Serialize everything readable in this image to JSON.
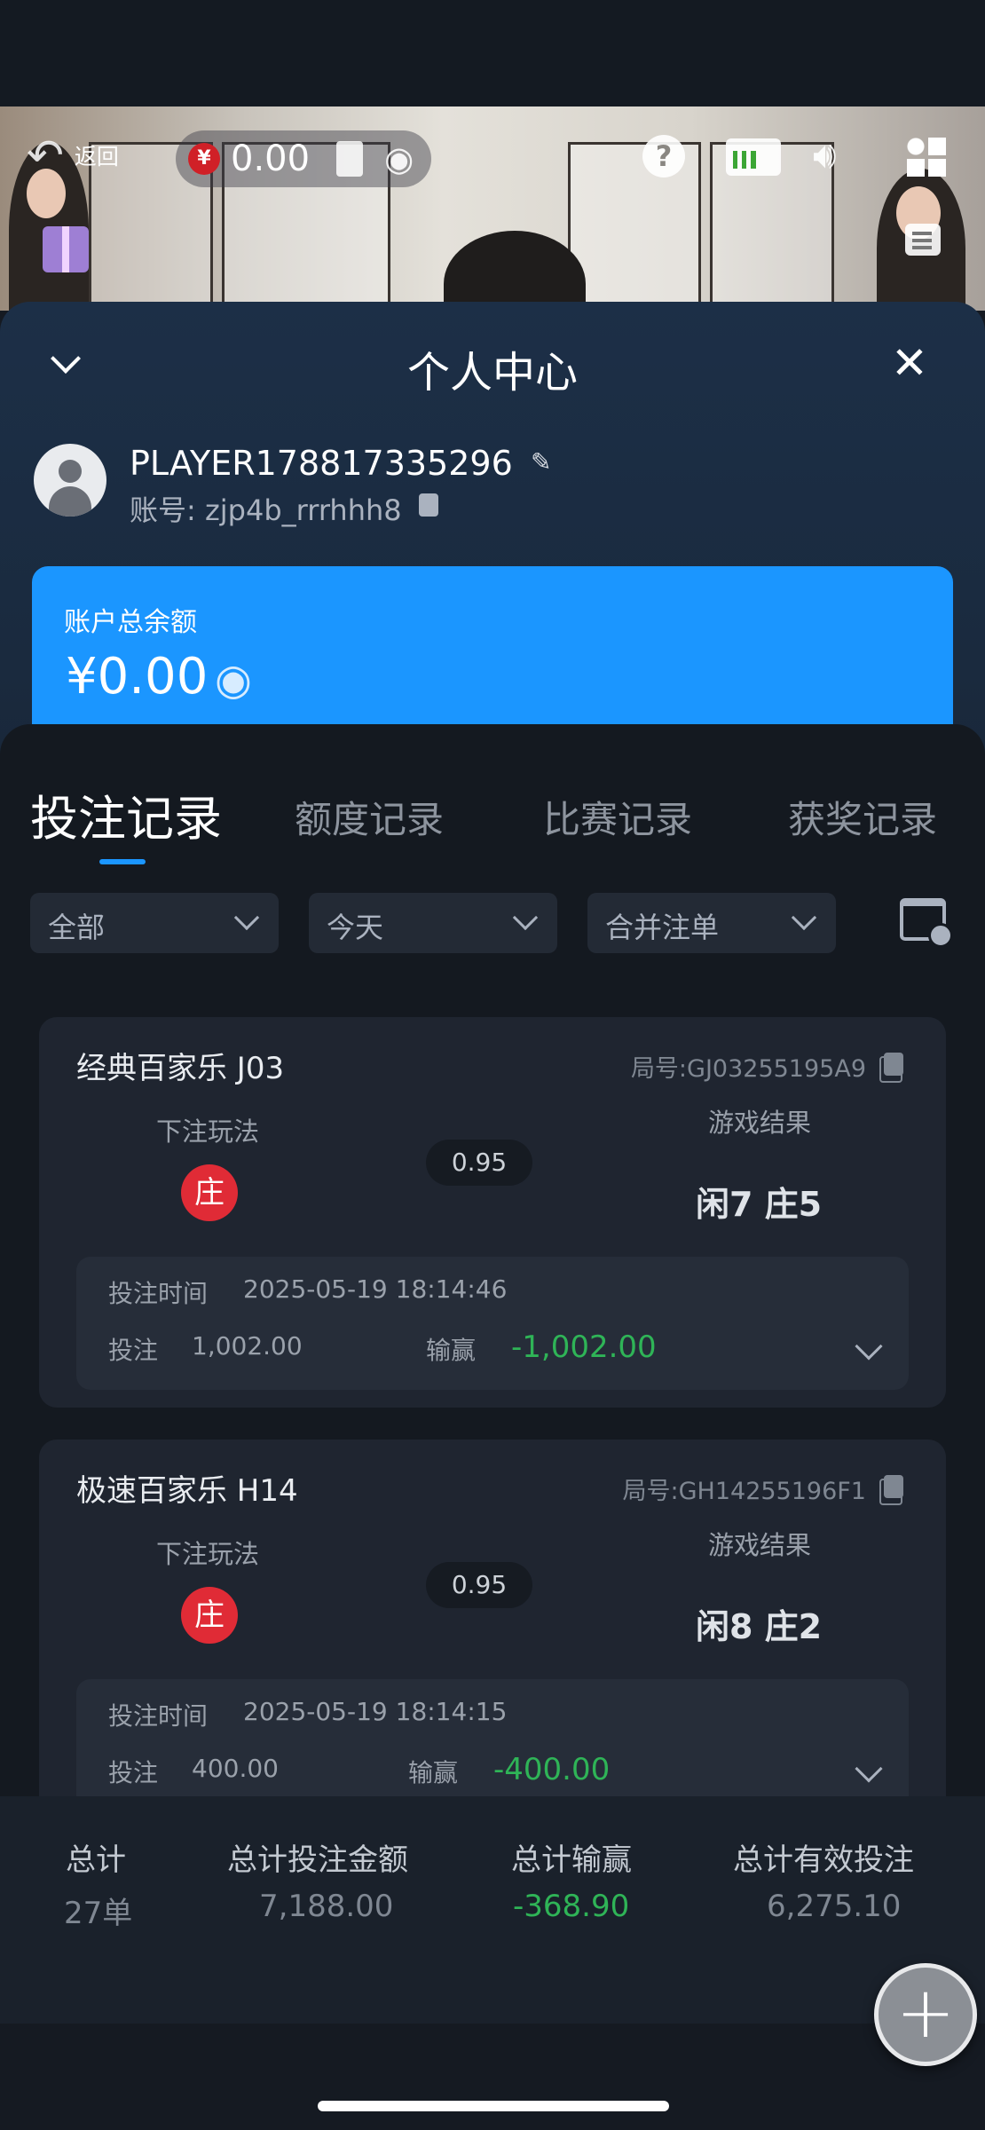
{
  "video_bar": {
    "back_label": "返回",
    "currency_symbol": "¥",
    "balance": "0.00"
  },
  "sheet": {
    "title": "个人中心"
  },
  "profile": {
    "name": "PLAYER178817335296",
    "account": "账号: zjp4b_rrrhhh8"
  },
  "balance_card": {
    "label": "账户总余额",
    "amount": "¥0.00"
  },
  "tabs": [
    {
      "label": "投注记录",
      "active": true
    },
    {
      "label": "额度记录",
      "active": false
    },
    {
      "label": "比赛记录",
      "active": false
    },
    {
      "label": "获奖记录",
      "active": false
    }
  ],
  "filters": [
    {
      "value": "全部"
    },
    {
      "value": "今天"
    },
    {
      "value": "合并注单"
    }
  ],
  "records": [
    {
      "game": "经典百家乐 J03",
      "round": "局号:GJ03255195A9",
      "play_label": "下注玩法",
      "bet": "庄",
      "odds": "0.95",
      "result_label": "游戏结果",
      "result": "闲7 庄5",
      "time_label": "投注时间",
      "time": "2025-05-19 18:14:46",
      "stake_label": "投注",
      "stake": "1,002.00",
      "winloss_label": "输赢",
      "winloss": "-1,002.00"
    },
    {
      "game": "极速百家乐 H14",
      "round": "局号:GH14255196F1",
      "play_label": "下注玩法",
      "bet": "庄",
      "odds": "0.95",
      "result_label": "游戏结果",
      "result": "闲8 庄2",
      "time_label": "投注时间",
      "time": "2025-05-19 18:14:15",
      "stake_label": "投注",
      "stake": "400.00",
      "winloss_label": "输赢",
      "winloss": "-400.00"
    }
  ],
  "summary": {
    "total_label": "总计",
    "total_value": "27单",
    "bet_amount_label": "总计投注金额",
    "bet_amount_value": "7,188.00",
    "winloss_label": "总计输赢",
    "winloss_value": "-368.90",
    "valid_bet_label": "总计有效投注",
    "valid_bet_value": "6,275.10"
  },
  "colors": {
    "accent": "#1b96ff",
    "bet_badge": "#e02b36",
    "loss_green": "#2fb457"
  }
}
